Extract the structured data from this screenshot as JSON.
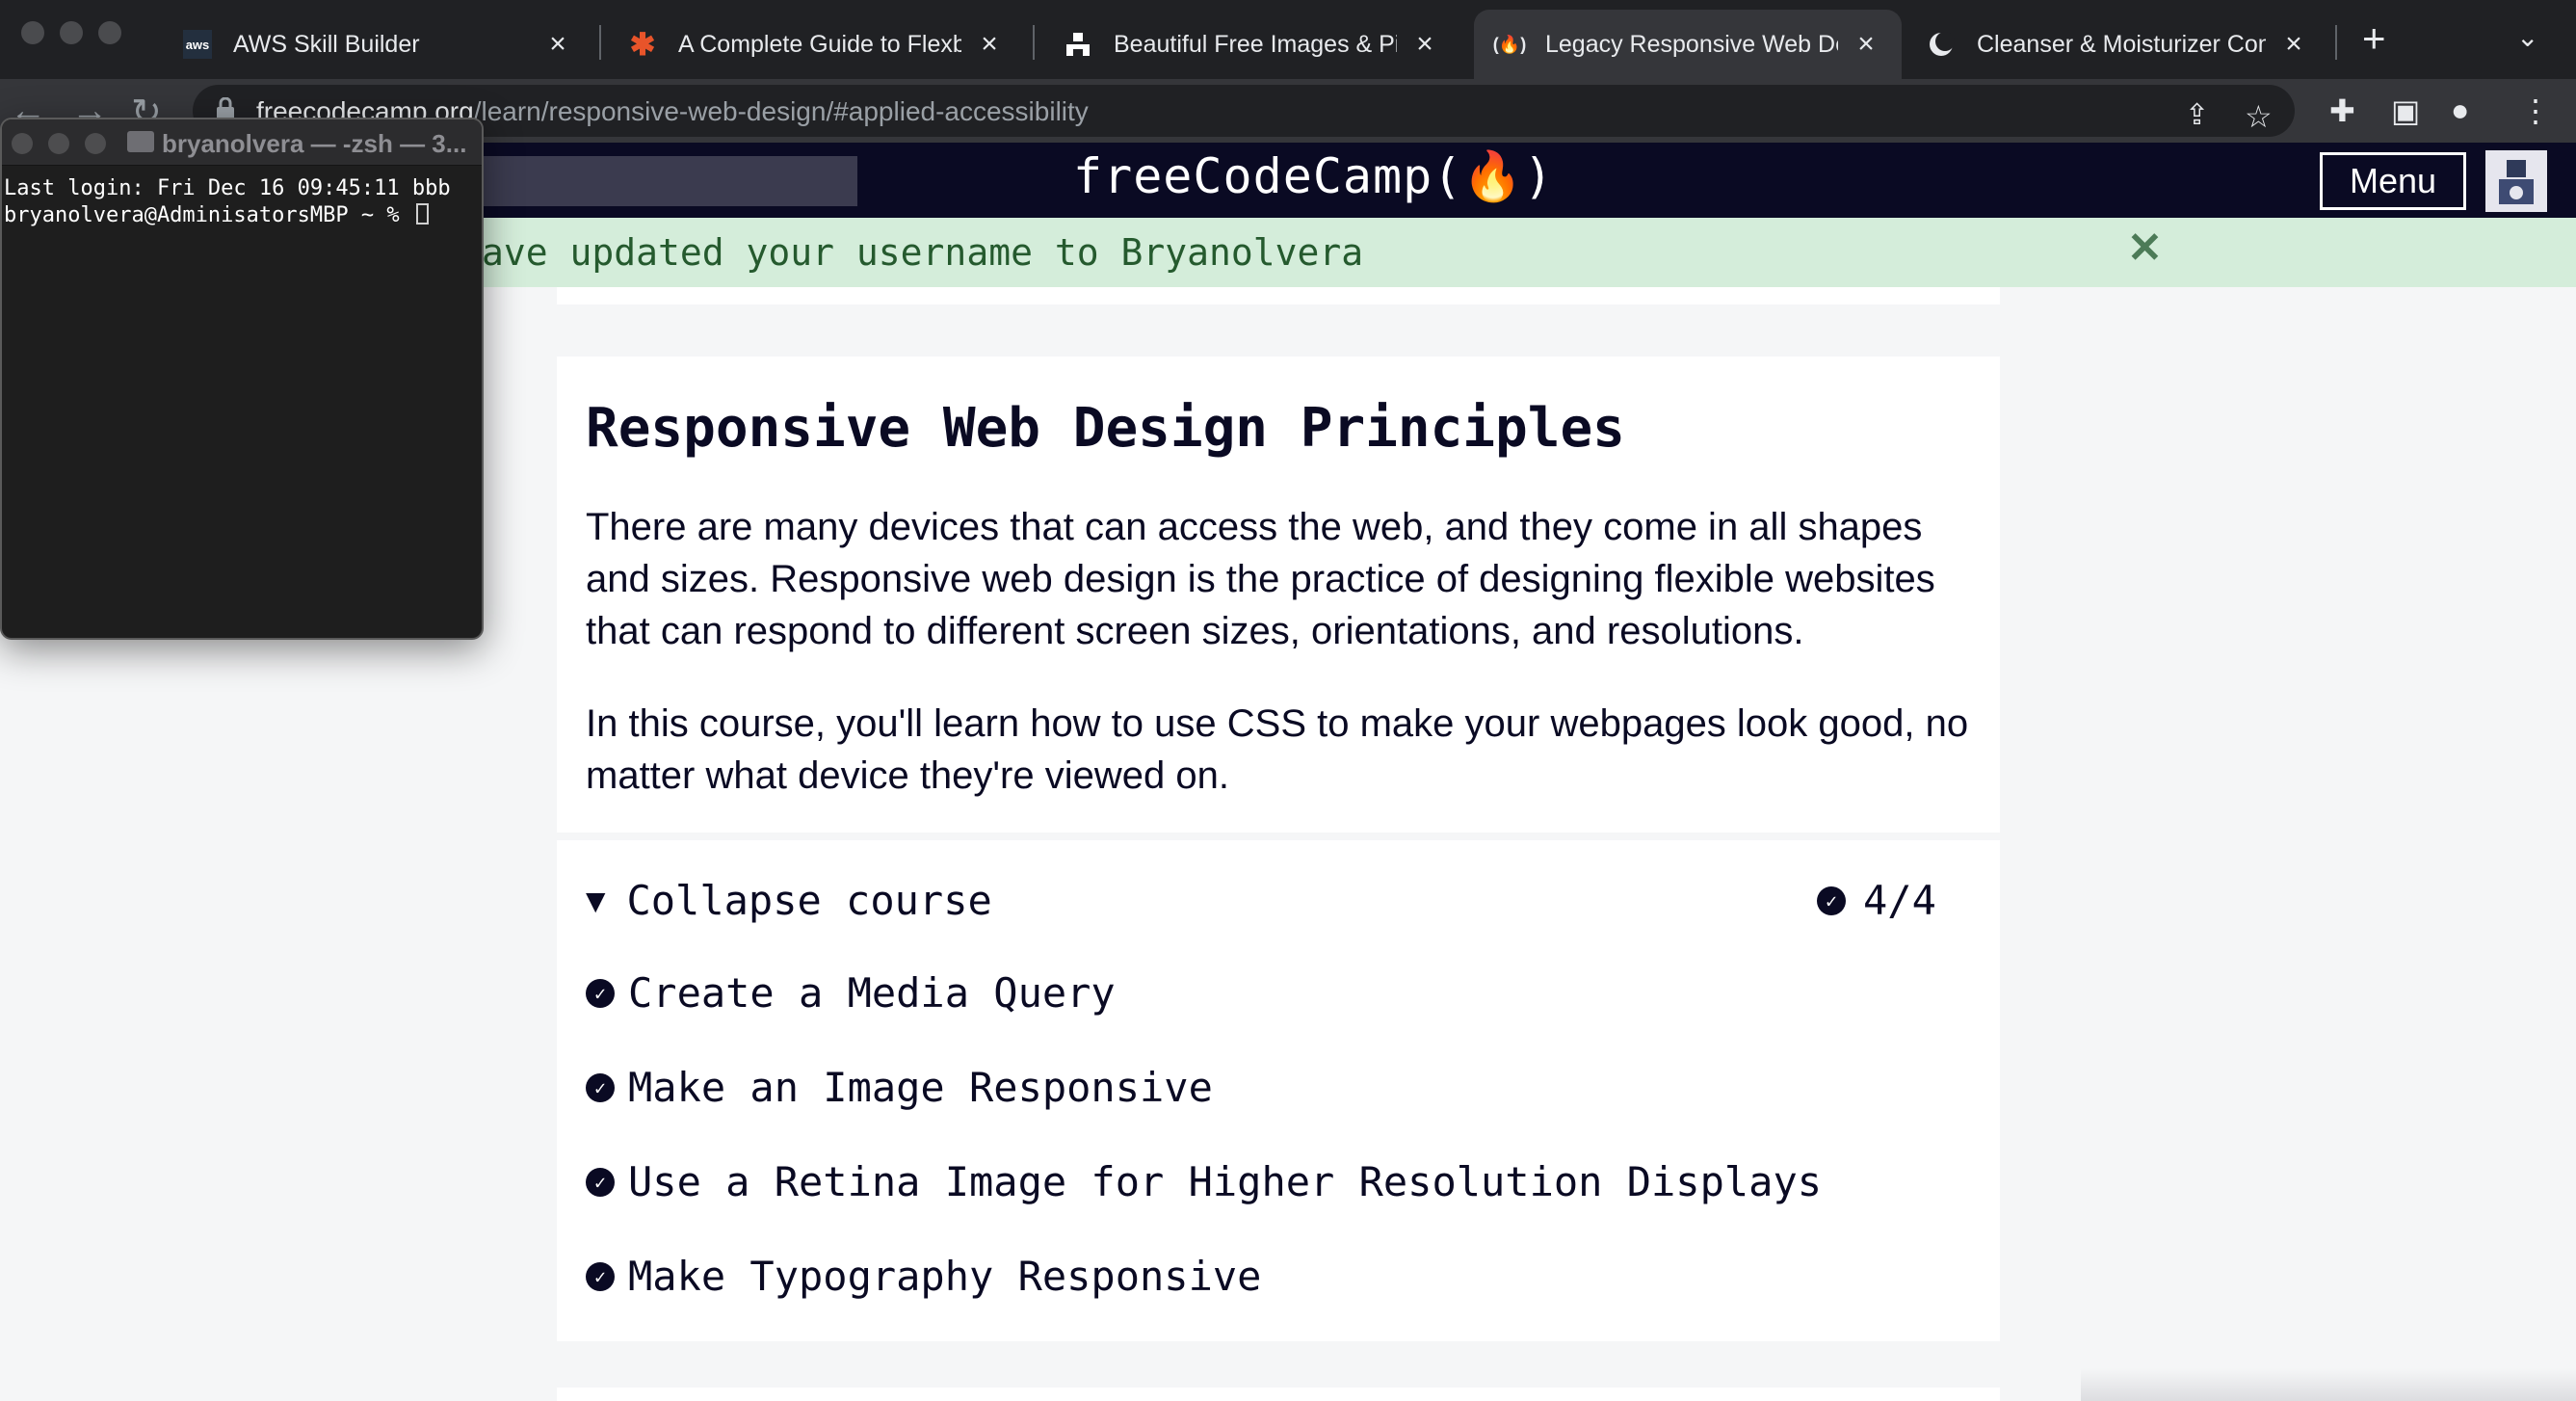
{
  "browser": {
    "tabs": [
      {
        "title": "AWS Skill Builder",
        "favicon": "aws-icon",
        "active": false
      },
      {
        "title": "A Complete Guide to Flexbox",
        "favicon": "css-tricks-icon",
        "active": false
      },
      {
        "title": "Beautiful Free Images & Pictures",
        "favicon": "unsplash-icon",
        "active": false
      },
      {
        "title": "Legacy Responsive Web Design",
        "favicon": "freecodecamp-icon",
        "active": true
      },
      {
        "title": "Cleanser & Moisturizer Combo",
        "favicon": "store-icon",
        "active": false
      }
    ],
    "new_tab_label": "+",
    "url_host": "freecodecamp.org",
    "url_path": "/learn/responsive-web-design/#applied-accessibility"
  },
  "terminal": {
    "title": "bryanolvera — -zsh — 3...",
    "line1": "Last login: Fri Dec 16 09:45:11 bbb",
    "prompt": "bryanolvera@AdminisatorsMBP ~ % "
  },
  "navbar": {
    "logo": "freeCodeCamp(🔥)",
    "menu_label": "Menu"
  },
  "flash": {
    "message": "ave updated your username to Bryanolvera",
    "close": "✕"
  },
  "intro": {
    "heading": "Responsive Web Design Principles",
    "paragraph1": "There are many devices that can access the web, and they come in all shapes and sizes. Responsive web design is the practice of designing flexible websites that can respond to different screen sizes, orientations, and resolutions.",
    "paragraph2": "In this course, you'll learn how to use CSS to make your webpages look good, no matter what device they're viewed on."
  },
  "course": {
    "toggle_arrow": "▼",
    "collapse_label": "Collapse course",
    "progress": "4/4",
    "lessons": [
      {
        "title": "Create a Media Query",
        "completed": true
      },
      {
        "title": "Make an Image Responsive",
        "completed": true
      },
      {
        "title": "Use a Retina Image for Higher Resolution Displays",
        "completed": true
      },
      {
        "title": "Make Typography Responsive",
        "completed": true
      }
    ]
  },
  "colors": {
    "navbar_bg": "#0a0a23",
    "flash_bg": "#d4edda",
    "flash_text": "#255a2e",
    "page_bg": "#f5f6f7"
  }
}
